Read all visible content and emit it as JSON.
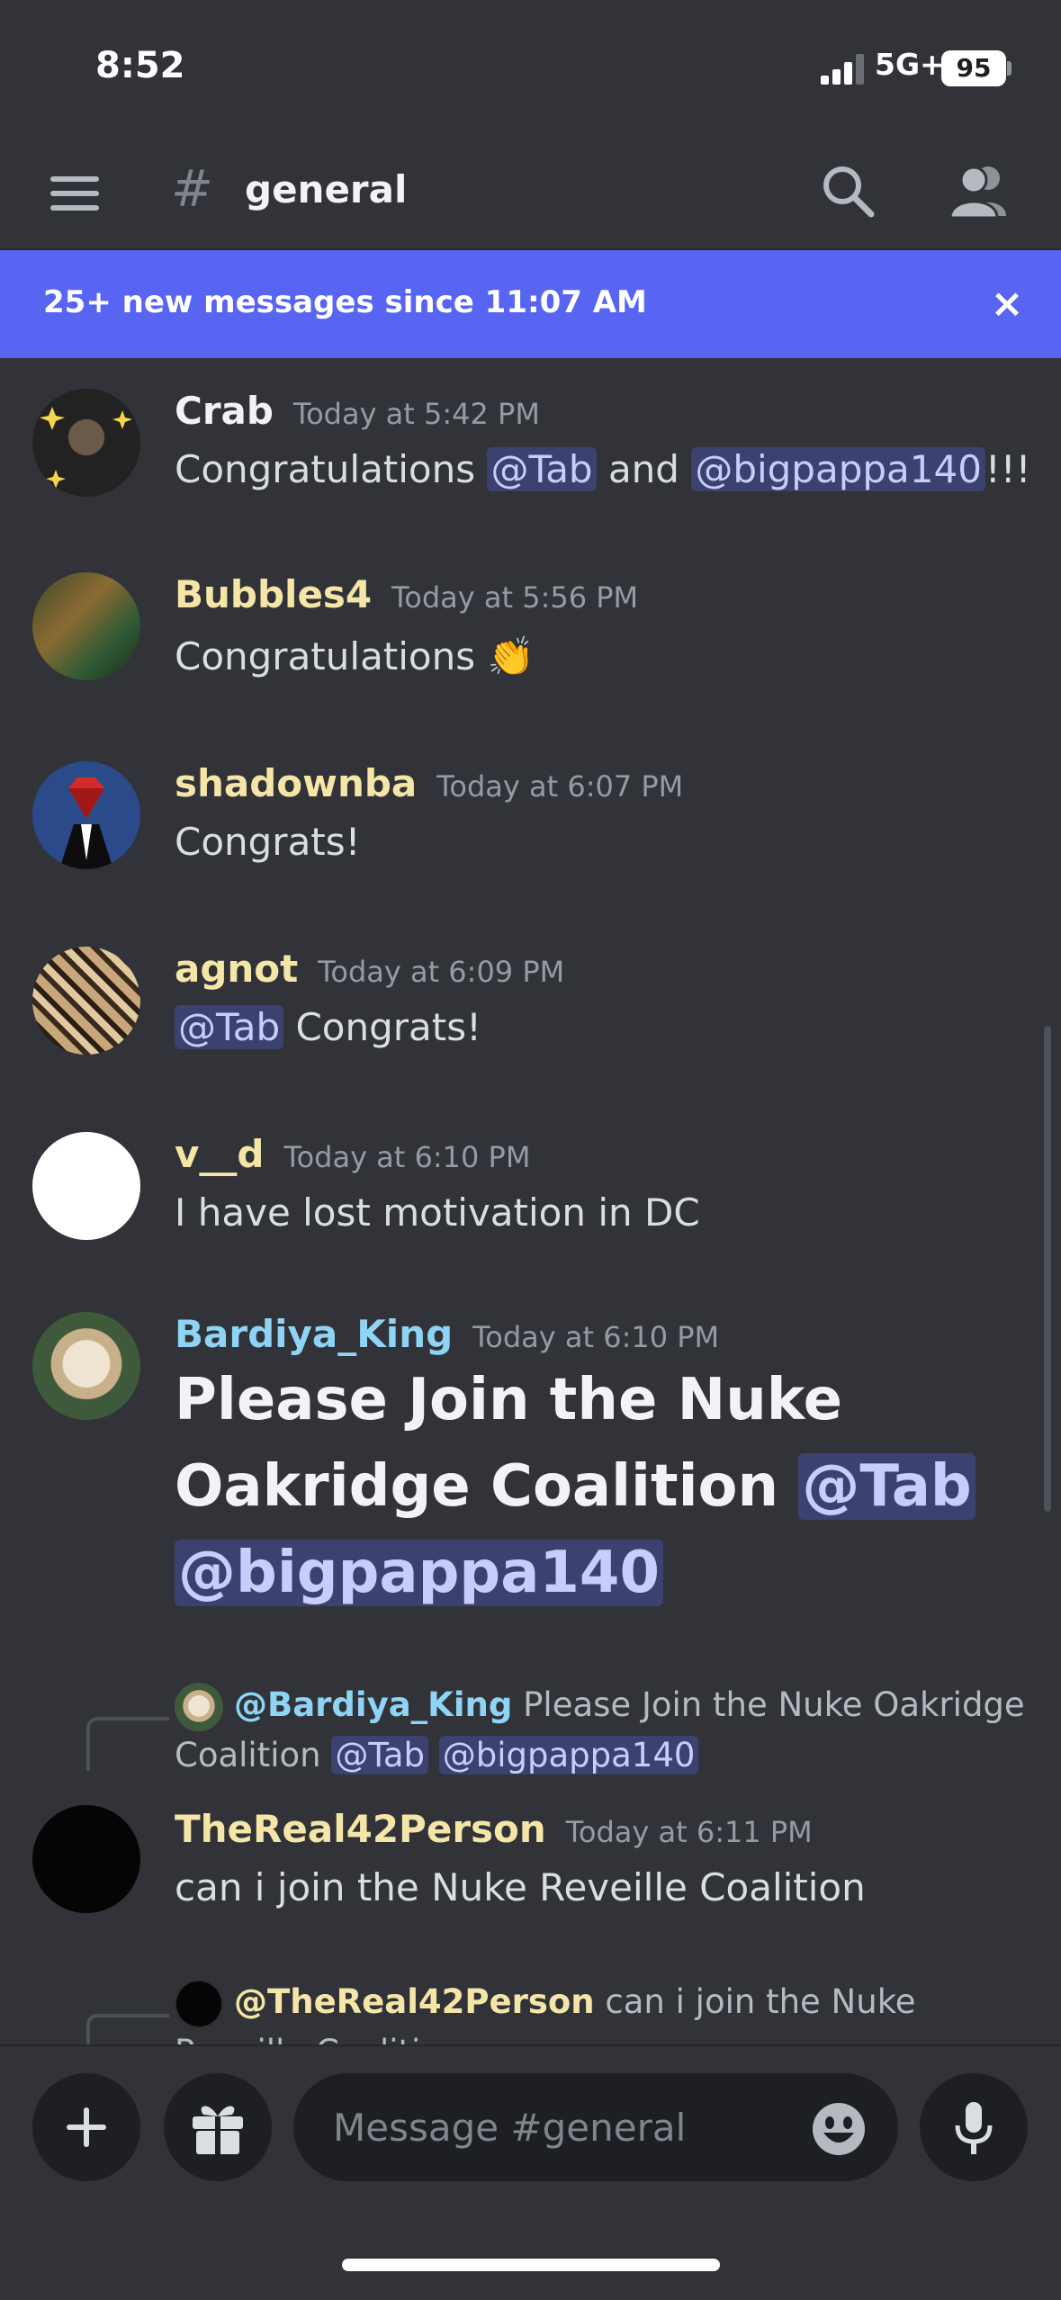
{
  "status_bar": {
    "time": "8:52",
    "network": "5G+",
    "battery": "95"
  },
  "header": {
    "hash": "#",
    "channel": "general"
  },
  "new_messages_bar": {
    "text": "25+ new messages since 11:07 AM",
    "close": "×"
  },
  "messages": [
    {
      "username": "Crab",
      "user_color": "#f2f3f5",
      "timestamp": "Today at 5:42 PM",
      "text_before": "Congratulations ",
      "mention1": "@Tab",
      "text_mid": " and ",
      "mention2": "@bigpappa140",
      "text_after": "!!!"
    },
    {
      "username": "Bubbles4",
      "user_color": "#f5e6a8",
      "timestamp": "Today at 5:56 PM",
      "text": "Congratulations 👏"
    },
    {
      "username": "shadownba",
      "user_color": "#f5e6a8",
      "timestamp": "Today at 6:07 PM",
      "text": "Congrats!"
    },
    {
      "username": "agnot",
      "user_color": "#f5e6a8",
      "timestamp": "Today at 6:09 PM",
      "mention": "@Tab",
      "text": " Congrats!"
    },
    {
      "username": "v__d",
      "user_color": "#f5e6a8",
      "timestamp": "Today at 6:10 PM",
      "text": "I have lost motivation in DC"
    },
    {
      "username": "Bardiya_King",
      "user_color": "#8fd4f5",
      "timestamp": "Today at 6:10 PM",
      "text": "Please Join the Nuke Oakridge Coalition ",
      "mention1": "@Tab",
      "mention2": "@bigpappa140"
    },
    {
      "reply": {
        "user": "@Bardiya_King",
        "user_color": "#8fd4f5",
        "text": " Please Join the Nuke Oakridge Coalition ",
        "mention1": "@Tab",
        "mention2": "@bigpappa140"
      },
      "username": "TheReal42Person",
      "user_color": "#f5e6a8",
      "timestamp": "Today at 6:11 PM",
      "text": "can i join the Nuke Reveille Coalition"
    },
    {
      "reply": {
        "user": "@TheReal42Person",
        "user_color": "#f5e6a8",
        "text": " can i join the Nuke Reveille Coalition"
      }
    }
  ],
  "composer": {
    "placeholder": "Message #general"
  }
}
